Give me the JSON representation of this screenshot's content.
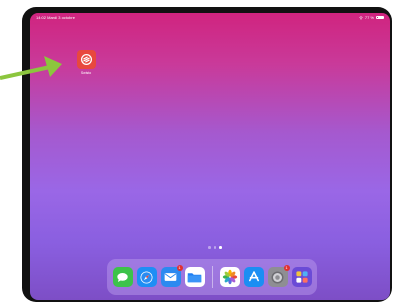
{
  "status_bar": {
    "time_date": "14:02  Mardi 3 octobre",
    "battery": "77 %"
  },
  "home": {
    "app_label": "Swisto",
    "page_count": 3,
    "active_page": 3
  },
  "dock": {
    "items": [
      {
        "name": "messages-app-icon",
        "color": "#3cc34a",
        "badge": ""
      },
      {
        "name": "safari-app-icon",
        "color": "#1e8ef5",
        "badge": ""
      },
      {
        "name": "mail-app-icon",
        "color": "#2b8af0",
        "badge": "1"
      },
      {
        "name": "files-app-icon",
        "color": "#1f7ef2",
        "badge": ""
      },
      {
        "name": "photos-app-icon",
        "color": "#ffffff",
        "badge": ""
      },
      {
        "name": "app-store-icon",
        "color": "#1b8ef3",
        "badge": ""
      },
      {
        "name": "settings-app-icon",
        "color": "#8e8e93",
        "badge": "1"
      },
      {
        "name": "app-library-icon",
        "color": "#6b4bd6",
        "badge": ""
      }
    ]
  },
  "colors": {
    "arrow": "#8cc63e",
    "app_icon": "#e8483e"
  }
}
